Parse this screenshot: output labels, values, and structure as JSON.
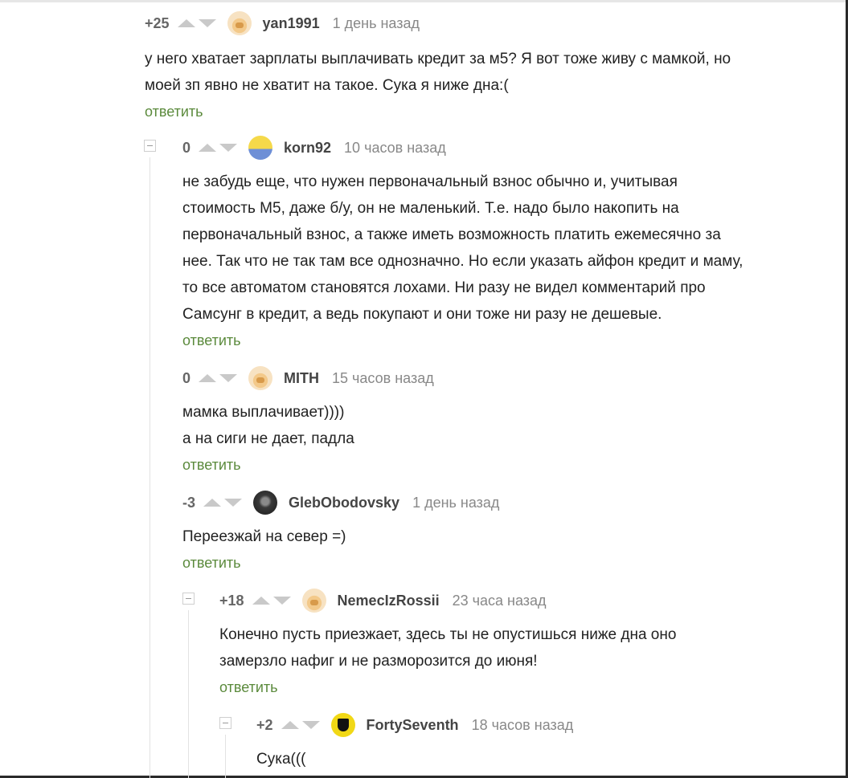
{
  "comments": [
    {
      "rating": "+25",
      "username": "yan1991",
      "time": "1 день назад",
      "avatar": "default-avatar-icon",
      "lines": [
        "у него хватает зарплаты выплачивать кредит за м5? Я вот тоже живу с мамкой, но",
        "моей зп явно не хватит на такое. Сука я ниже дна:("
      ],
      "reply": "ответить"
    },
    {
      "rating": "0",
      "username": "korn92",
      "time": "10 часов назад",
      "avatar": "simpson-avatar-icon",
      "lines": [
        "не забудь еще, что нужен первоначальный взнос обычно и, учитывая",
        "стоимость М5, даже б/у, он не маленький. Т.е. надо было накопить на",
        "первоначальный взнос, а также иметь возможность платить ежемесячно за",
        "нее. Так что не так там все однозначно. Но если указать айфон кредит и маму,",
        "то все автоматом становятся лохами. Ни разу не видел комментарий про",
        "Самсунг в кредит, а ведь покупают и они тоже ни разу не дешевые."
      ],
      "reply": "ответить"
    },
    {
      "rating": "0",
      "username": "MITH",
      "time": "15 часов назад",
      "avatar": "default-avatar-icon",
      "lines": [
        "мамка выплачивает))))",
        "а на сиги не дает, падла"
      ],
      "reply": "ответить"
    },
    {
      "rating": "-3",
      "username": "GlebObodovsky",
      "time": "1 день назад",
      "avatar": "dark-avatar-icon",
      "lines": [
        "Переезжай на север =)"
      ],
      "reply": "ответить"
    },
    {
      "rating": "+18",
      "username": "NemecIzRossii",
      "time": "23 часа назад",
      "avatar": "default-avatar-icon",
      "lines": [
        "Конечно пусть приезжает, здесь ты не опустишься ниже дна оно",
        "замерзло нафиг и не разморозится до июня!"
      ],
      "reply": "ответить"
    },
    {
      "rating": "+2",
      "username": "FortySeventh",
      "time": "18 часов назад",
      "avatar": "wutang-avatar-icon",
      "lines": [
        "Сука((("
      ],
      "reply": ""
    }
  ]
}
